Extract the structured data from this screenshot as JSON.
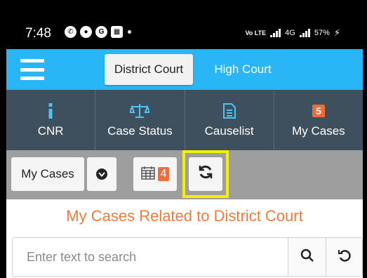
{
  "status_bar": {
    "time": "7:48",
    "left_icons": [
      "whatsapp-icon",
      "jio-icon",
      "google-icon",
      "gallery-icon"
    ],
    "volte_label": "Vo LTE",
    "network_label": "4G",
    "battery": "57%"
  },
  "app_bar": {
    "tabs": [
      {
        "label": "District Court",
        "selected": true
      },
      {
        "label": "High Court",
        "selected": false
      }
    ]
  },
  "nav": {
    "items": [
      {
        "label": "CNR",
        "icon": "info-icon"
      },
      {
        "label": "Case Status",
        "icon": "scale-icon"
      },
      {
        "label": "Causelist",
        "icon": "document-icon"
      },
      {
        "label": "My Cases",
        "icon": "count-badge",
        "badge": "5"
      }
    ]
  },
  "toolbar": {
    "my_cases_label": "My Cases",
    "calendar_count": "4",
    "highlight_color": "#f5f000"
  },
  "main": {
    "title": "My Cases Related to District Court",
    "search_placeholder": "Enter text to search"
  },
  "colors": {
    "app_bar": "#29b6f6",
    "nav_bar": "#3e4f5d",
    "accent_orange": "#ef6c3a",
    "toolbar": "#9e9e9e"
  }
}
